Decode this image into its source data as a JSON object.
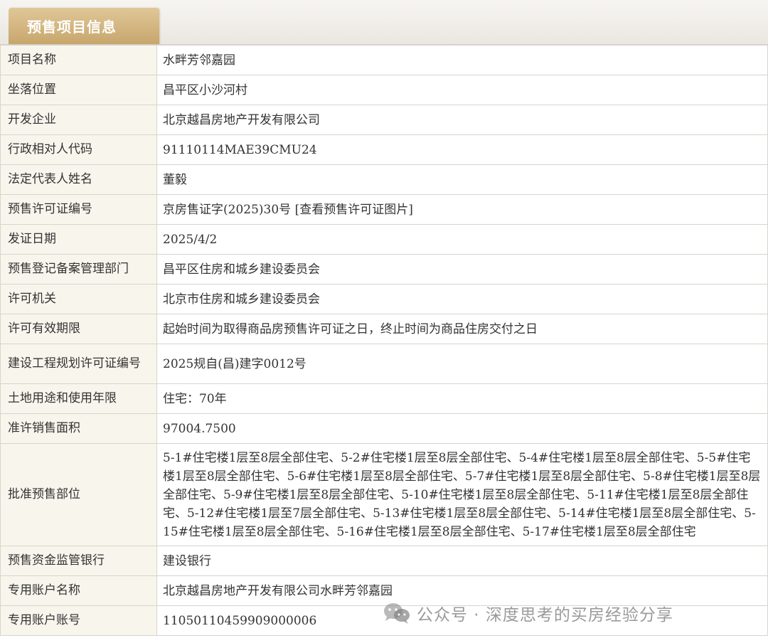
{
  "section": {
    "tab_title": "预售项目信息"
  },
  "rows": [
    {
      "label": "项目名称",
      "value": "水畔芳邻嘉园"
    },
    {
      "label": "坐落位置",
      "value": "昌平区小沙河村"
    },
    {
      "label": "开发企业",
      "value": "北京越昌房地产开发有限公司"
    },
    {
      "label": "行政相对人代码",
      "value": "91110114MAE39CMU24"
    },
    {
      "label": "法定代表人姓名",
      "value": "董毅"
    },
    {
      "label": "预售许可证编号",
      "value": "京房售证字(2025)30号",
      "link": "[查看预售许可证图片]"
    },
    {
      "label": "发证日期",
      "value": "2025/4/2"
    },
    {
      "label": "预售登记备案管理部门",
      "value": "昌平区住房和城乡建设委员会"
    },
    {
      "label": "许可机关",
      "value": "北京市住房和城乡建设委员会"
    },
    {
      "label": "许可有效期限",
      "value": "起始时间为取得商品房预售许可证之日，终止时间为商品住房交付之日"
    },
    {
      "label": "建设工程规划许可证编号",
      "value": "2025规自(昌)建字0012号"
    },
    {
      "label": "土地用途和使用年限",
      "value": "住宅：70年"
    },
    {
      "label": "准许销售面积",
      "value": "97004.7500"
    },
    {
      "label": "批准预售部位",
      "value": "5-1#住宅楼1层至8层全部住宅、5-2#住宅楼1层至8层全部住宅、5-4#住宅楼1层至8层全部住宅、5-5#住宅楼1层至8层全部住宅、5-6#住宅楼1层至8层全部住宅、5-7#住宅楼1层至8层全部住宅、5-8#住宅楼1层至8层全部住宅、5-9#住宅楼1层至8层全部住宅、5-10#住宅楼1层至8层全部住宅、5-11#住宅楼1层至8层全部住宅、5-12#住宅楼1层至7层全部住宅、5-13#住宅楼1层至8层全部住宅、5-14#住宅楼1层至8层全部住宅、5-15#住宅楼1层至8层全部住宅、5-16#住宅楼1层至8层全部住宅、5-17#住宅楼1层至8层全部住宅"
    },
    {
      "label": "预售资金监管银行",
      "value": "建设银行"
    },
    {
      "label": "专用账户名称",
      "value": "北京越昌房地产开发有限公司水畔芳邻嘉园"
    },
    {
      "label": "专用账户账号",
      "value": "11050110459909000006"
    }
  ],
  "watermark": {
    "text": "公众号 · 深度思考的买房经验分享",
    "icon": "wechat-icon"
  }
}
